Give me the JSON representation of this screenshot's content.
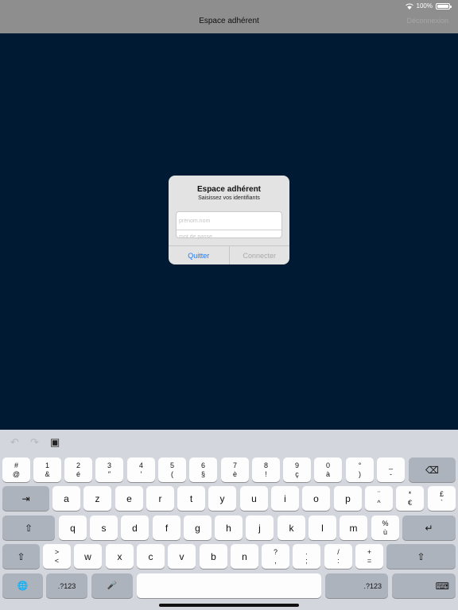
{
  "status": {
    "battery": "100%"
  },
  "nav": {
    "title": "Espace adhérent",
    "right_button": "Déconnexion"
  },
  "alert": {
    "title": "Espace adhérent",
    "message": "Saisissez vos identifiants",
    "username_placeholder": "prénom.nom",
    "password_placeholder": "mot de passe",
    "quit_label": "Quitter",
    "connect_label": "Connecter"
  },
  "keyboard": {
    "toolbar": {
      "undo_icon": "↶",
      "redo_icon": "↷",
      "paste_icon": "▣"
    },
    "row1": [
      {
        "top": "#",
        "bottom": "@"
      },
      {
        "top": "1",
        "bottom": "&"
      },
      {
        "top": "2",
        "bottom": "é"
      },
      {
        "top": "3",
        "bottom": "″"
      },
      {
        "top": "4",
        "bottom": "′"
      },
      {
        "top": "5",
        "bottom": "("
      },
      {
        "top": "6",
        "bottom": "§"
      },
      {
        "top": "7",
        "bottom": "è"
      },
      {
        "top": "8",
        "bottom": "!"
      },
      {
        "top": "9",
        "bottom": "ç"
      },
      {
        "top": "0",
        "bottom": "à"
      },
      {
        "top": "°",
        "bottom": ")"
      },
      {
        "top": "_",
        "bottom": "-"
      }
    ],
    "row2_letters": [
      "a",
      "z",
      "e",
      "r",
      "t",
      "y",
      "u",
      "i",
      "o",
      "p"
    ],
    "row2_extra": [
      {
        "top": "¨",
        "bottom": "^"
      },
      {
        "top": "*",
        "bottom": "€"
      },
      {
        "top": "£",
        "bottom": "`"
      }
    ],
    "row3_letters": [
      "q",
      "s",
      "d",
      "f",
      "g",
      "h",
      "j",
      "k",
      "l",
      "m"
    ],
    "row3_extra": {
      "top": "%",
      "bottom": "ù"
    },
    "row4_first": {
      "top": ">",
      "bottom": "<"
    },
    "row4_letters": [
      "w",
      "x",
      "c",
      "v",
      "b",
      "n"
    ],
    "row4_punct": [
      {
        "top": "?",
        "bottom": ","
      },
      {
        "top": ".",
        "bottom": ";"
      },
      {
        "top": "/",
        "bottom": ":"
      },
      {
        "top": "+",
        "bottom": "="
      }
    ],
    "numbers_label": ".?123",
    "icons": {
      "backspace": "⌫",
      "tab": "⇥",
      "shift": "⇧",
      "return": "↵",
      "globe": "🌐",
      "mic": "🎤",
      "hide_keyboard": "⌨"
    }
  }
}
